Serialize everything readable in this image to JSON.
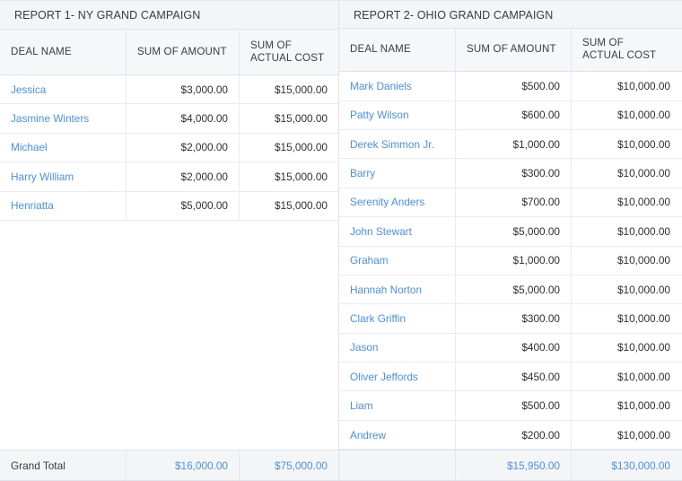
{
  "reports": [
    {
      "title": "REPORT 1- NY GRAND CAMPAIGN",
      "columns": {
        "deal_name": "DEAL NAME",
        "sum_of_amount": "SUM OF AMOUNT",
        "sum_of_actual_cost": "SUM OF\nACTUAL COST",
        "sum_of_actual_cost_line1": "SUM OF",
        "sum_of_actual_cost_line2": "ACTUAL COST"
      },
      "rows": [
        {
          "deal_name": "Jessica",
          "amount": "$3,000.00",
          "actual_cost": "$15,000.00"
        },
        {
          "deal_name": "Jasmine Winters",
          "amount": "$4,000.00",
          "actual_cost": "$15,000.00"
        },
        {
          "deal_name": "Michael",
          "amount": "$2,000.00",
          "actual_cost": "$15,000.00"
        },
        {
          "deal_name": "Harry William",
          "amount": "$2,000.00",
          "actual_cost": "$15,000.00"
        },
        {
          "deal_name": "Henriatta",
          "amount": "$5,000.00",
          "actual_cost": "$15,000.00"
        }
      ],
      "grand_total": {
        "label": "Grand Total",
        "amount": "$16,000.00",
        "actual_cost": "$75,000.00"
      }
    },
    {
      "title": "REPORT 2- OHIO GRAND CAMPAIGN",
      "columns": {
        "deal_name": "DEAL NAME",
        "sum_of_amount": "SUM OF AMOUNT",
        "sum_of_actual_cost": "SUM OF\nACTUAL COST",
        "sum_of_actual_cost_line1": "SUM OF",
        "sum_of_actual_cost_line2": "ACTUAL COST"
      },
      "rows": [
        {
          "deal_name": "Mark Daniels",
          "amount": "$500.00",
          "actual_cost": "$10,000.00"
        },
        {
          "deal_name": "Patty Wilson",
          "amount": "$600.00",
          "actual_cost": "$10,000.00"
        },
        {
          "deal_name": "Derek Simmon Jr.",
          "amount": "$1,000.00",
          "actual_cost": "$10,000.00"
        },
        {
          "deal_name": "Barry",
          "amount": "$300.00",
          "actual_cost": "$10,000.00"
        },
        {
          "deal_name": "Serenity Anders",
          "amount": "$700.00",
          "actual_cost": "$10,000.00"
        },
        {
          "deal_name": "John Stewart",
          "amount": "$5,000.00",
          "actual_cost": "$10,000.00"
        },
        {
          "deal_name": "Graham",
          "amount": "$1,000.00",
          "actual_cost": "$10,000.00"
        },
        {
          "deal_name": "Hannah Norton",
          "amount": "$5,000.00",
          "actual_cost": "$10,000.00"
        },
        {
          "deal_name": "Clark Griffin",
          "amount": "$300.00",
          "actual_cost": "$10,000.00"
        },
        {
          "deal_name": "Jason",
          "amount": "$400.00",
          "actual_cost": "$10,000.00"
        },
        {
          "deal_name": "Oliver Jeffords",
          "amount": "$450.00",
          "actual_cost": "$10,000.00"
        },
        {
          "deal_name": "Liam",
          "amount": "$500.00",
          "actual_cost": "$10,000.00"
        },
        {
          "deal_name": "Andrew",
          "amount": "$200.00",
          "actual_cost": "$10,000.00"
        }
      ],
      "grand_total": {
        "label": "",
        "amount": "$15,950.00",
        "actual_cost": "$130,000.00"
      }
    }
  ],
  "colors": {
    "link": "#4a90e8",
    "header_bg": "#f4f5f7",
    "border": "#dfe3e8",
    "text": "#333333"
  }
}
